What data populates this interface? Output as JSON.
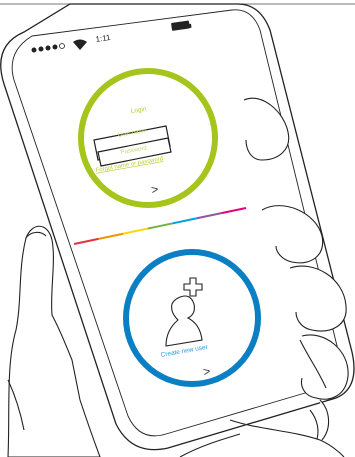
{
  "status_bar": {
    "time": "1:11",
    "signal_dots": 5,
    "icons": [
      "signal-dots-icon",
      "wifi-icon",
      "battery-icon"
    ]
  },
  "login": {
    "title": "Login",
    "username_placeholder": "User name",
    "password_placeholder": "Password",
    "forgot_link": "Forgot name or password",
    "next_glyph": ">",
    "ring_color": "#a6c51c",
    "text_color": "#b9cf2e"
  },
  "divider": {
    "colors": [
      "#e2333f",
      "#f29400",
      "#ffd500",
      "#6fb43f",
      "#00a0e0",
      "#8e57a5",
      "#e6007e"
    ]
  },
  "create": {
    "label": "Create new user",
    "next_glyph": ">",
    "ring_color": "#0a7fc4",
    "text_color": "#2b9ad8",
    "icon": "add-user-icon"
  },
  "colors": {
    "outline": "#222222",
    "background": "#ffffff"
  }
}
